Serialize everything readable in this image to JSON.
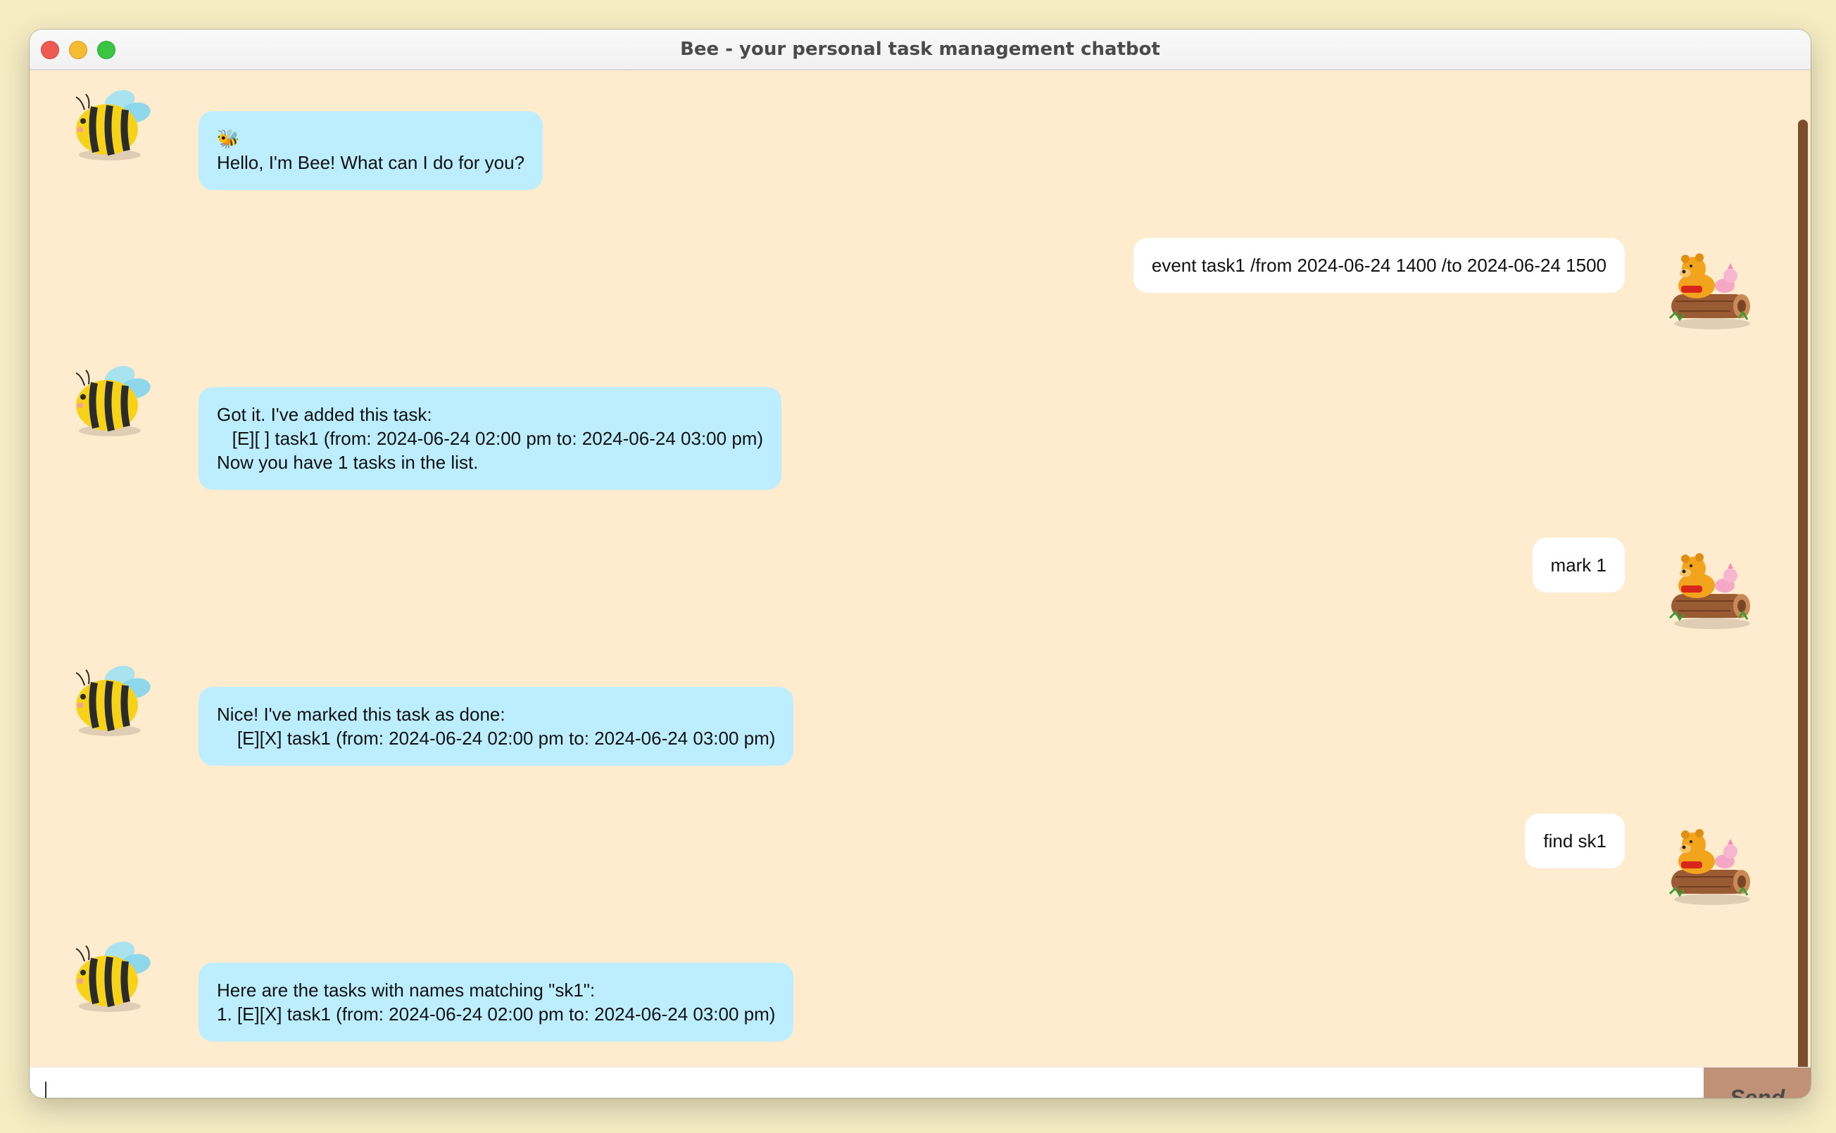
{
  "window": {
    "title": "Bee - your personal task management chatbot"
  },
  "messages": [
    {
      "from": "bot",
      "text": "🐝\nHello, I'm Bee! What can I do for you?"
    },
    {
      "from": "user",
      "text": "event task1 /from 2024-06-24 1400 /to 2024-06-24 1500"
    },
    {
      "from": "bot",
      "text": "Got it. I've added this task:\n   [E][ ] task1 (from: 2024-06-24 02:00 pm to: 2024-06-24 03:00 pm)\nNow you have 1 tasks in the list."
    },
    {
      "from": "user",
      "text": "mark 1"
    },
    {
      "from": "bot",
      "text": "Nice! I've marked this task as done:\n    [E][X] task1 (from: 2024-06-24 02:00 pm to: 2024-06-24 03:00 pm)"
    },
    {
      "from": "user",
      "text": "find sk1"
    },
    {
      "from": "bot",
      "text": "Here are the tasks with names matching \"sk1\":\n1. [E][X] task1 (from: 2024-06-24 02:00 pm to: 2024-06-24 03:00 pm)"
    }
  ],
  "input": {
    "value": "",
    "send_label": "Send"
  },
  "icons": {
    "bot_avatar": "bee-avatar-icon",
    "user_avatar": "pooh-piglet-log-avatar-icon"
  },
  "colors": {
    "chat_background": "#ffebcd",
    "bot_bubble": "#bdeeff",
    "user_bubble": "#ffffff",
    "send_button": "#c09176",
    "scrollbar": "#7a4e2e"
  }
}
